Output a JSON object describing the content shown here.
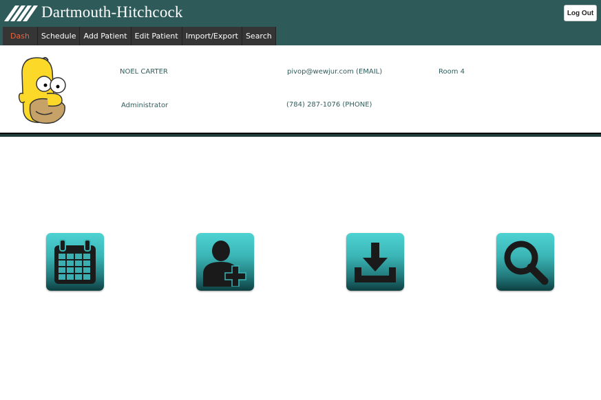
{
  "header": {
    "brand": "Dartmouth-Hitchcock",
    "logout_label": "Log Out"
  },
  "nav": {
    "items": [
      {
        "label": "Dash",
        "active": true
      },
      {
        "label": "Schedule"
      },
      {
        "label": "Add Patient"
      },
      {
        "label": "Edit Patient"
      },
      {
        "label": "Import/Export"
      },
      {
        "label": "Search"
      }
    ]
  },
  "profile": {
    "name": "NOEL CARTER",
    "role": "Administrator",
    "email": "pivop@wewjur.com (EMAIL)",
    "phone": "(784) 287-1076 (PHONE)",
    "room": "Room 4"
  },
  "tiles": [
    {
      "icon": "calendar-icon",
      "action": "Schedule"
    },
    {
      "icon": "add-user-icon",
      "action": "Add Patient"
    },
    {
      "icon": "download-icon",
      "action": "Import/Export"
    },
    {
      "icon": "search-icon",
      "action": "Search"
    }
  ],
  "colors": {
    "header_bg": "#2e5b5a",
    "nav_bg": "#353535",
    "nav_active": "#e8643c",
    "profile_text": "#2f5c5b",
    "tile_teal": "#3bb5b6"
  }
}
